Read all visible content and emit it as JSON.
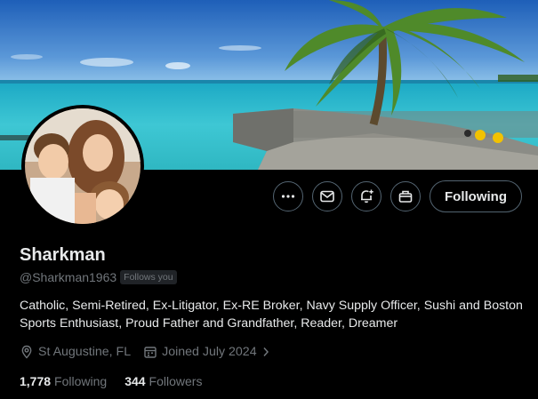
{
  "profile": {
    "name": "Sharkman",
    "handle": "@Sharkman1963",
    "follows_you_badge": "Follows you",
    "bio": "Catholic, Semi-Retired, Ex-Litigator, Ex-RE Broker, Navy Supply Officer, Sushi and Boston Sports Enthusiast, Proud Father and Grandfather, Reader, Dreamer",
    "location": "St Augustine, FL",
    "joined": "Joined July 2024"
  },
  "stats": {
    "following_count": "1,778",
    "following_label": "Following",
    "followers_count": "344",
    "followers_label": "Followers"
  },
  "actions": {
    "following_button_label": "Following",
    "icons": [
      "more-icon",
      "message-icon",
      "notify-bell-icon",
      "subscribe-gift-icon"
    ]
  },
  "colors": {
    "background": "#000000",
    "text_primary": "#e7e9ea",
    "text_secondary": "#71767b",
    "border": "#536471"
  }
}
